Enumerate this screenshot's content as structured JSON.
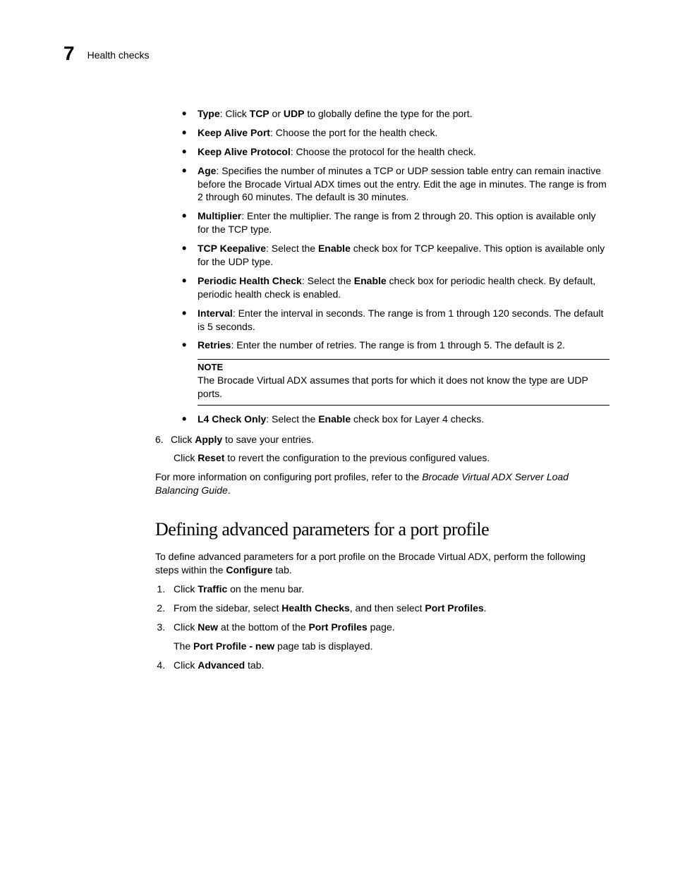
{
  "header": {
    "chapter_number": "7",
    "chapter_title": "Health checks"
  },
  "bullets": [
    {
      "term": "Type",
      "sep": ": Click ",
      "bold2": "TCP",
      "mid": " or ",
      "bold3": "UDP",
      "rest": " to globally define the type for the port."
    },
    {
      "term": "Keep Alive Port",
      "sep": ": ",
      "rest": "Choose the port for the health check."
    },
    {
      "term": "Keep Alive Protocol",
      "sep": ": ",
      "rest": "Choose the protocol for the health check."
    },
    {
      "term": "Age",
      "sep": ": ",
      "rest": "Specifies the number of minutes a TCP or UDP session table entry can remain inactive before the Brocade Virtual ADX times out the entry. Edit the age in minutes. The range is from 2 through 60 minutes. The default is 30 minutes."
    },
    {
      "term": "Multiplier",
      "sep": ": ",
      "rest": "Enter the multiplier. The range is from 2 through 20. This option is available only for the TCP type."
    },
    {
      "term": "TCP Keepalive",
      "sep": ": Select the ",
      "bold2": "Enable",
      "rest": " check box for TCP keepalive. This option is available only for the UDP type."
    },
    {
      "term": "Periodic Health Check",
      "sep": ": Select the ",
      "bold2": "Enable",
      "rest": " check box for periodic health check. By default, periodic health check is enabled."
    },
    {
      "term": "Interval",
      "sep": ": ",
      "rest": "Enter the interval in seconds. The range is from 1 through 120 seconds. The default is 5 seconds."
    },
    {
      "term": "Retries",
      "sep": ": ",
      "rest": "Enter the number of retries. The range is from 1 through 5. The default is 2."
    }
  ],
  "note": {
    "label": "NOTE",
    "body": "The Brocade Virtual ADX assumes that ports for which it does not know the type are UDP ports."
  },
  "bullet_after_note": {
    "term": "L4 Check Only",
    "sep": ": Select the ",
    "bold2": "Enable",
    "rest": " check box for Layer 4 checks."
  },
  "step6": {
    "num": "6.",
    "pre": "Click ",
    "bold1": "Apply",
    "post1": " to save your entries.",
    "sub_pre": "Click ",
    "sub_bold": "Reset",
    "sub_post": " to revert the configuration to the previous configured values."
  },
  "more_info": {
    "pre": "For more information on configuring port profiles, refer to the ",
    "italic": "Brocade Virtual ADX Server Load Balancing Guide",
    "post": "."
  },
  "section2": {
    "heading": "Defining advanced parameters for a port profile",
    "intro_pre": "To define advanced parameters for a port profile on the Brocade Virtual ADX, perform the following steps within the ",
    "intro_bold": "Configure",
    "intro_post": " tab.",
    "steps": {
      "s1": {
        "pre": "Click ",
        "b1": "Traffic",
        "post": " on the menu bar."
      },
      "s2": {
        "pre": "From the sidebar, select ",
        "b1": "Health Checks",
        "mid": ", and then select ",
        "b2": "Port Profiles",
        "post": "."
      },
      "s3": {
        "pre": "Click ",
        "b1": "New",
        "mid": " at the bottom of the ",
        "b2": "Port Profiles",
        "post": " page.",
        "sub_pre": "The ",
        "sub_b": "Port Profile - new",
        "sub_post": " page tab is displayed."
      },
      "s4": {
        "pre": "Click ",
        "b1": "Advanced",
        "post": " tab."
      }
    }
  }
}
